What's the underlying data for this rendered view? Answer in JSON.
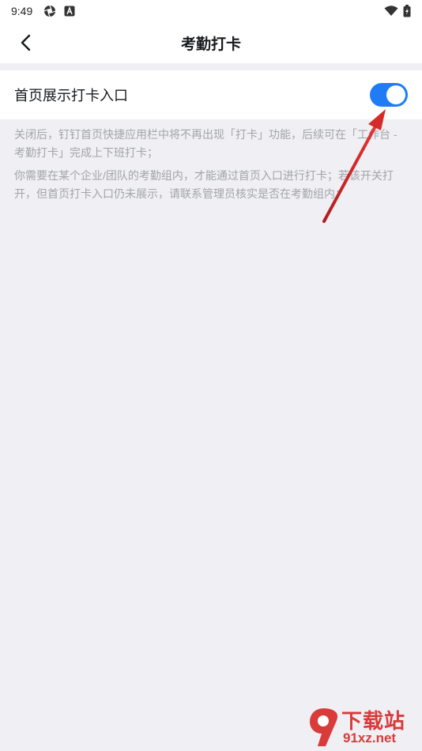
{
  "status_bar": {
    "time": "9:49"
  },
  "nav": {
    "title": "考勤打卡"
  },
  "setting": {
    "label": "首页展示打卡入口",
    "toggle_on": true
  },
  "descriptions": [
    "关闭后，钉钉首页快捷应用栏中将不再出现「打卡」功能，后续可在「工作台 - 考勤打卡」完成上下班打卡；",
    "你需要在某个企业/团队的考勤组内，才能通过首页入口进行打卡；若该开关打开，但首页打卡入口仍未展示，请联系管理员核实是否在考勤组内；"
  ],
  "watermark": {
    "line1": "下载站",
    "line2": "91xz.net"
  },
  "colors": {
    "accent": "#1f7cf5",
    "annotation_arrow": "#d62a2a",
    "background": "#efeff4"
  }
}
